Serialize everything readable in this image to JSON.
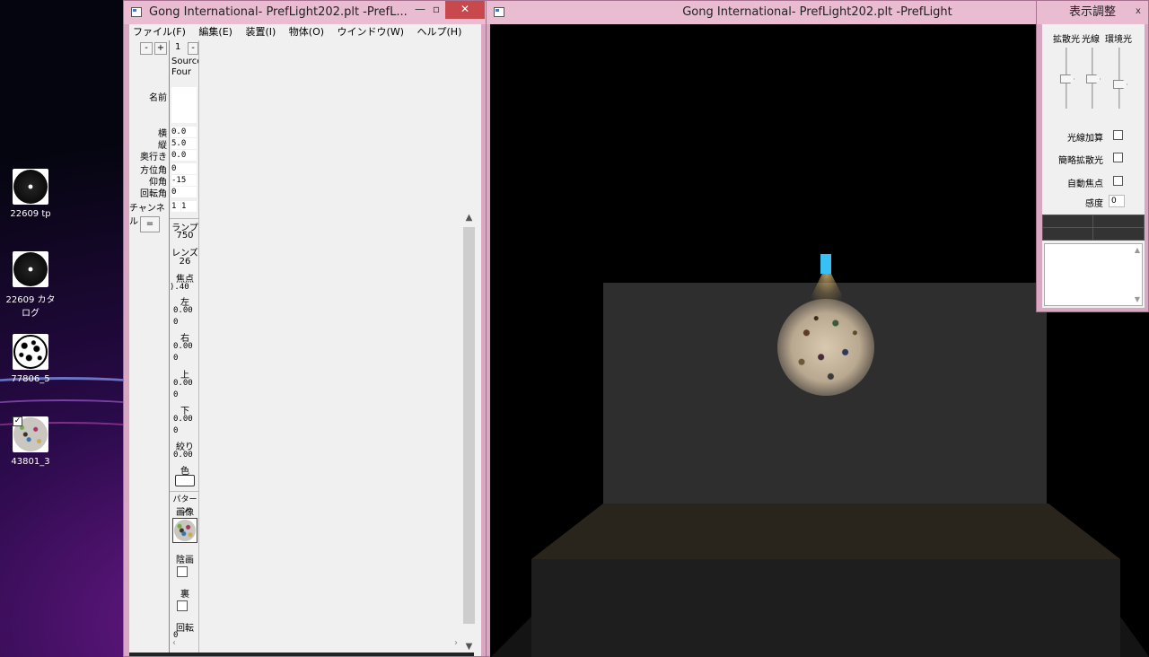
{
  "desktop": {
    "icons": [
      {
        "label": "22609 tp",
        "type": "spark"
      },
      {
        "label": "22609 カタログ",
        "type": "spark"
      },
      {
        "label": "77806_5",
        "type": "dots"
      },
      {
        "label": "43801_3",
        "type": "granite",
        "checked": true
      }
    ]
  },
  "left_window": {
    "title": "Gong International- PrefLight202.plt -PrefL...",
    "menu": [
      "ファイル(F)",
      "編集(E)",
      "装置(I)",
      "物体(O)",
      "ウインドウ(W)",
      "ヘルプ(H)"
    ],
    "minus": "-",
    "plus": "+",
    "index": "1",
    "index_minus": "-",
    "source_name": [
      "Source",
      "Four"
    ],
    "labels": {
      "name": "名前",
      "x": "横",
      "y": "縦",
      "z": "奥行き",
      "azimuth": "方位角",
      "elevation": "仰角",
      "rotation": "回転角",
      "channel": "チャンネル",
      "equals": "="
    },
    "values": {
      "x": "0.0",
      "y": "5.0",
      "z": "0.0",
      "azimuth": "0",
      "elevation": "-15",
      "rotation": "0",
      "channel": "1",
      "channel2": "1"
    },
    "props": {
      "lamp_label": "ランプ",
      "lamp_value": "750",
      "lens_label": "レンズ",
      "lens_value": "26",
      "focus_label": "焦点",
      "focus_value": ").40",
      "left_label": "左",
      "left_value": "0.00",
      "left_value2": "0",
      "right_label": "右",
      "right_value": "0.00",
      "right_value2": "0",
      "top_label": "上",
      "top_value": "0.00",
      "top_value2": "0",
      "bottom_label": "下",
      "bottom_value": "0.00",
      "bottom_value2": "0",
      "iris_label": "絞り",
      "iris_value": "0.00",
      "color_label": "色",
      "pattern_label": "パターン",
      "image_label": "画像",
      "negative_label": "陰画",
      "reverse_label": "裏",
      "rotate_label": "回転",
      "rotate_value": "0"
    }
  },
  "right_window": {
    "title": "Gong International- PrefLight202.plt -PrefLight"
  },
  "panel": {
    "title": "表示調整",
    "close": "x",
    "slider_labels": [
      "拡散光",
      "光線",
      "環境光"
    ],
    "options": [
      "光線加算",
      "簡略拡散光",
      "自動焦点"
    ],
    "sensitivity_label": "感度",
    "sensitivity_value": "0"
  }
}
